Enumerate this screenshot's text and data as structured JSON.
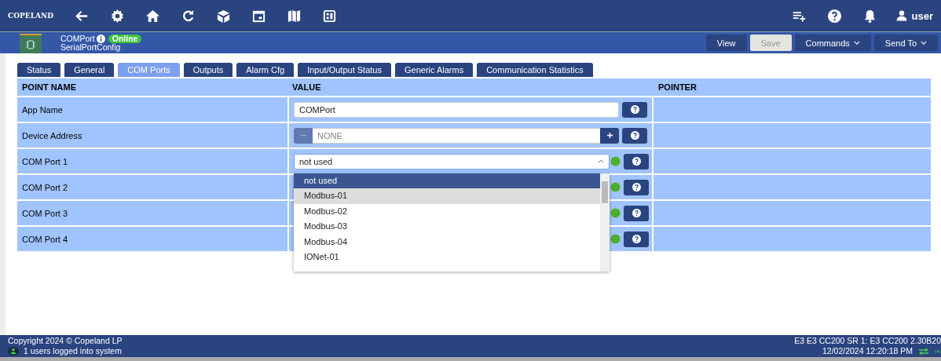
{
  "topbar": {
    "logo": "COPELAND",
    "user": "user"
  },
  "header": {
    "title": "COMPort",
    "status": "Online",
    "subtitle": "SerialPortConfig",
    "buttons": [
      {
        "label": "View",
        "disabled": false,
        "dropdown": false
      },
      {
        "label": "Save",
        "disabled": true,
        "dropdown": false
      },
      {
        "label": "Commands",
        "disabled": false,
        "dropdown": true
      },
      {
        "label": "Send To",
        "disabled": false,
        "dropdown": true
      }
    ]
  },
  "tabs": [
    {
      "label": "Status",
      "selected": false
    },
    {
      "label": "General",
      "selected": false
    },
    {
      "label": "COM Ports",
      "selected": true
    },
    {
      "label": "Outputs",
      "selected": false
    },
    {
      "label": "Alarm Cfg",
      "selected": false
    },
    {
      "label": "Input/Output Status",
      "selected": false
    },
    {
      "label": "Generic Alarms",
      "selected": false
    },
    {
      "label": "Communication Statistics",
      "selected": false
    }
  ],
  "table": {
    "columns": [
      "POINT NAME",
      "VALUE",
      "POINTER"
    ],
    "rows": [
      {
        "name": "App Name",
        "kind": "text",
        "value": "COMPort"
      },
      {
        "name": "Device Address",
        "kind": "address",
        "placeholder": "NONE"
      },
      {
        "name": "COM Port 1",
        "kind": "select",
        "value": "not used",
        "expanded": true
      },
      {
        "name": "COM Port 2",
        "kind": "select"
      },
      {
        "name": "COM Port 3",
        "kind": "select"
      },
      {
        "name": "COM Port 4",
        "kind": "select"
      }
    ]
  },
  "dropdown": {
    "options": [
      {
        "label": "not used",
        "selected": true,
        "highlighted": false
      },
      {
        "label": "Modbus-01",
        "selected": false,
        "highlighted": true
      },
      {
        "label": "Modbus-02",
        "selected": false,
        "highlighted": false
      },
      {
        "label": "Modbus-03",
        "selected": false,
        "highlighted": false
      },
      {
        "label": "Modbus-04",
        "selected": false,
        "highlighted": false
      },
      {
        "label": "IONet-01",
        "selected": false,
        "highlighted": false
      }
    ]
  },
  "footer": {
    "copyright": "Copyright 2024 © Copeland LP",
    "users": "1 users logged into system",
    "device": "E3 E3 CC200 SR 1: E3 CC200 2.30B20",
    "datetime": "12/02/2024 12:20:18 PM"
  }
}
